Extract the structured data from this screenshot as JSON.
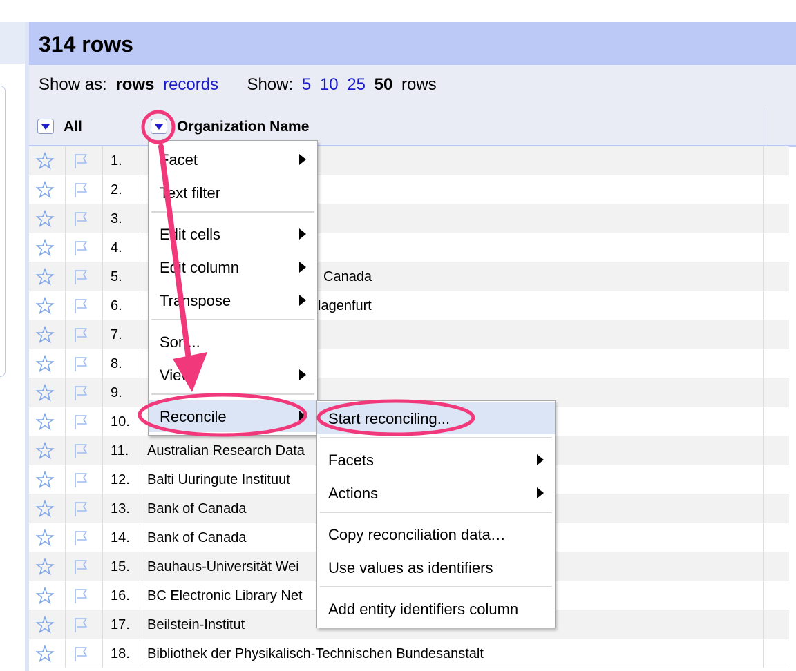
{
  "header": {
    "row_count": "314 rows"
  },
  "view_bar": {
    "show_as_label": "Show as:",
    "rows_option": "rows",
    "records_option": "records",
    "show_label": "Show:",
    "page_sizes": [
      "5",
      "10",
      "25",
      "50"
    ],
    "rows_suffix": "rows"
  },
  "columns": {
    "all_label": "All",
    "org_name_label": "Organization Name"
  },
  "rows": [
    {
      "num": "1.",
      "text": ""
    },
    {
      "num": "2.",
      "text": ""
    },
    {
      "num": "3.",
      "text": ""
    },
    {
      "num": "4.",
      "text": ""
    },
    {
      "num": "5.",
      "text": "Canada"
    },
    {
      "num": "6.",
      "text": "lagenfurt"
    },
    {
      "num": "7.",
      "text": ""
    },
    {
      "num": "8.",
      "text": ""
    },
    {
      "num": "9.",
      "text": ""
    },
    {
      "num": "10.",
      "text": ""
    },
    {
      "num": "11.",
      "text": "Australian Research Data"
    },
    {
      "num": "12.",
      "text": "Balti Uuringute Instituut"
    },
    {
      "num": "13.",
      "text": "Bank of Canada"
    },
    {
      "num": "14.",
      "text": "Bank of Canada"
    },
    {
      "num": "15.",
      "text": "Bauhaus-Universität Wei"
    },
    {
      "num": "16.",
      "text": "BC Electronic Library Net"
    },
    {
      "num": "17.",
      "text": "Beilstein-Institut"
    },
    {
      "num": "18.",
      "text": "Bibliothek der Physikalisch-Technischen Bundesanstalt"
    }
  ],
  "column_menu": {
    "facet": "Facet",
    "text_filter": "Text filter",
    "edit_cells": "Edit cells",
    "edit_column": "Edit column",
    "transpose": "Transpose",
    "sort": "Sort...",
    "view": "View",
    "reconcile": "Reconcile"
  },
  "reconcile_menu": {
    "start_reconciling": "Start reconciling...",
    "facets": "Facets",
    "actions": "Actions",
    "copy_data": "Copy reconciliation data…",
    "use_values": "Use values as identifiers",
    "add_entity_column": "Add entity identifiers column"
  },
  "colors": {
    "header_bg": "#bcc9f6",
    "link": "#1a1acd",
    "highlight": "#dbe5f5",
    "annotation": "#f0387a"
  }
}
